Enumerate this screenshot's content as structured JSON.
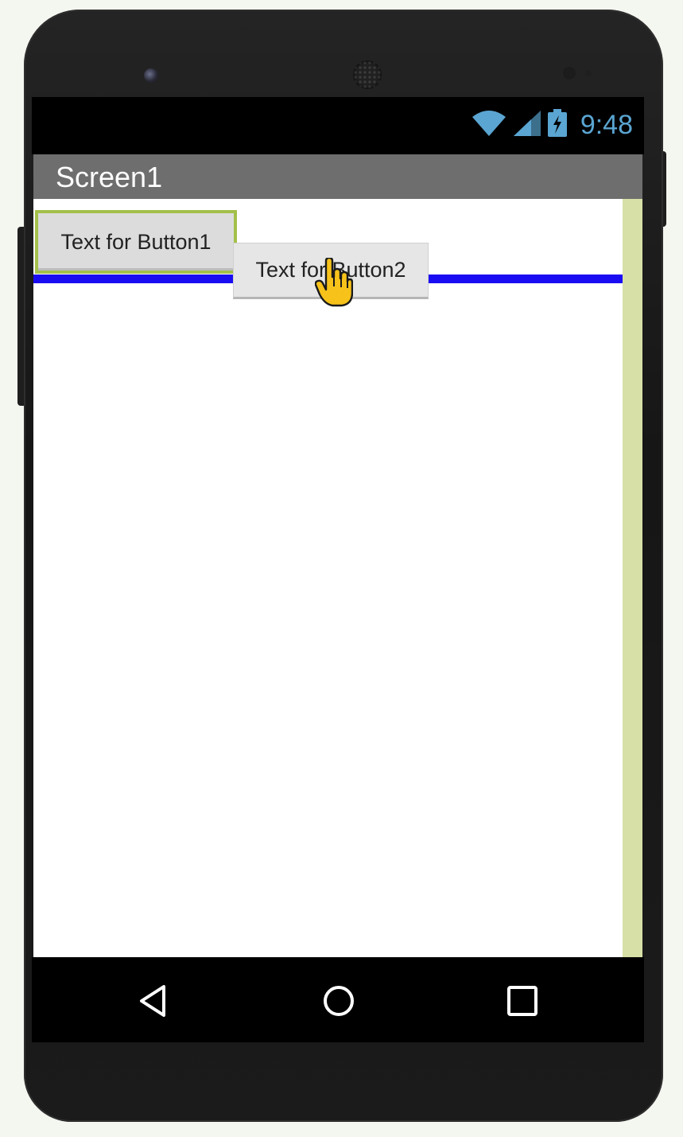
{
  "status_bar": {
    "time": "9:48",
    "icons": [
      "wifi-icon",
      "cell-signal-icon",
      "battery-charging-icon"
    ],
    "icon_color": "#5aa5d2"
  },
  "app_bar": {
    "title": "Screen1",
    "background": "#6e6e6e"
  },
  "screen": {
    "button1": {
      "label": "Text for Button1",
      "state": "selected",
      "highlight_color": "#a3c04a"
    },
    "button2": {
      "label": "Text for Button2",
      "state": "dragging"
    },
    "drop_indicator_color": "#1a0cf2",
    "cursor": "hand-pointer-icon"
  },
  "nav_bar": {
    "buttons": [
      "back-icon",
      "home-icon",
      "recents-icon"
    ]
  }
}
